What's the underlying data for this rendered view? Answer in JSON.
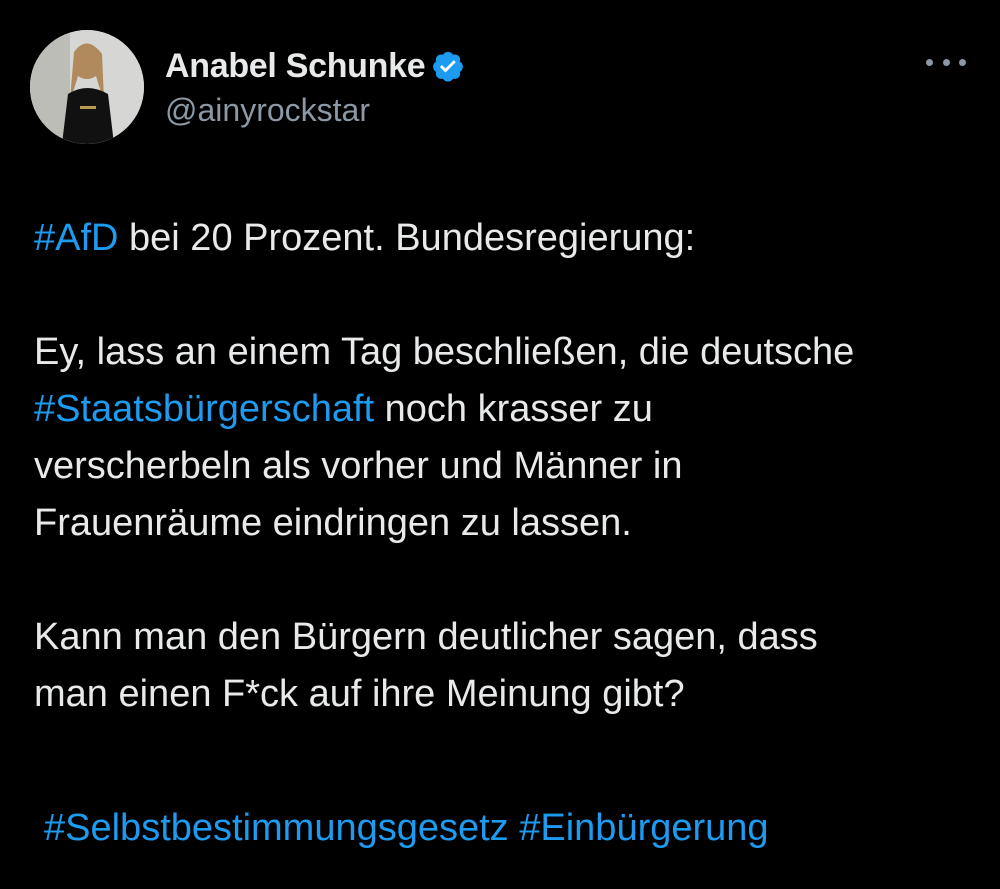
{
  "colors": {
    "background": "#000000",
    "text": "#e7e9ea",
    "secondary_text": "#8b98a5",
    "hashtag": "#1d9bf0",
    "verified_badge": "#1d9bf0"
  },
  "author": {
    "display_name": "Anabel Schunke",
    "handle": "@ainyrockstar",
    "verified_icon": "verified-badge-icon",
    "avatar_icon": "profile-photo"
  },
  "menu": {
    "icon": "more-options-icon"
  },
  "tweet": {
    "line1_hashtag": "#AfD",
    "line1_text": " bei 20 Prozent. Bundesregierung:",
    "p2_line1": "Ey, lass an einem Tag beschließen, die deutsche",
    "p2_hashtag": "#Staatsbürgerschaft",
    "p2_line2_rest": " noch krasser zu",
    "p2_line3": "verscherbeln als vorher und Männer in",
    "p2_line4": "Frauenräume eindringen zu lassen.",
    "p3_line1": "Kann man den Bürgern deutlicher sagen, dass",
    "p3_line2": "man einen F*ck auf ihre Meinung gibt?",
    "tag1": "#Selbstbestimmungsgesetz",
    "tag2": "#Einbürgerung"
  }
}
